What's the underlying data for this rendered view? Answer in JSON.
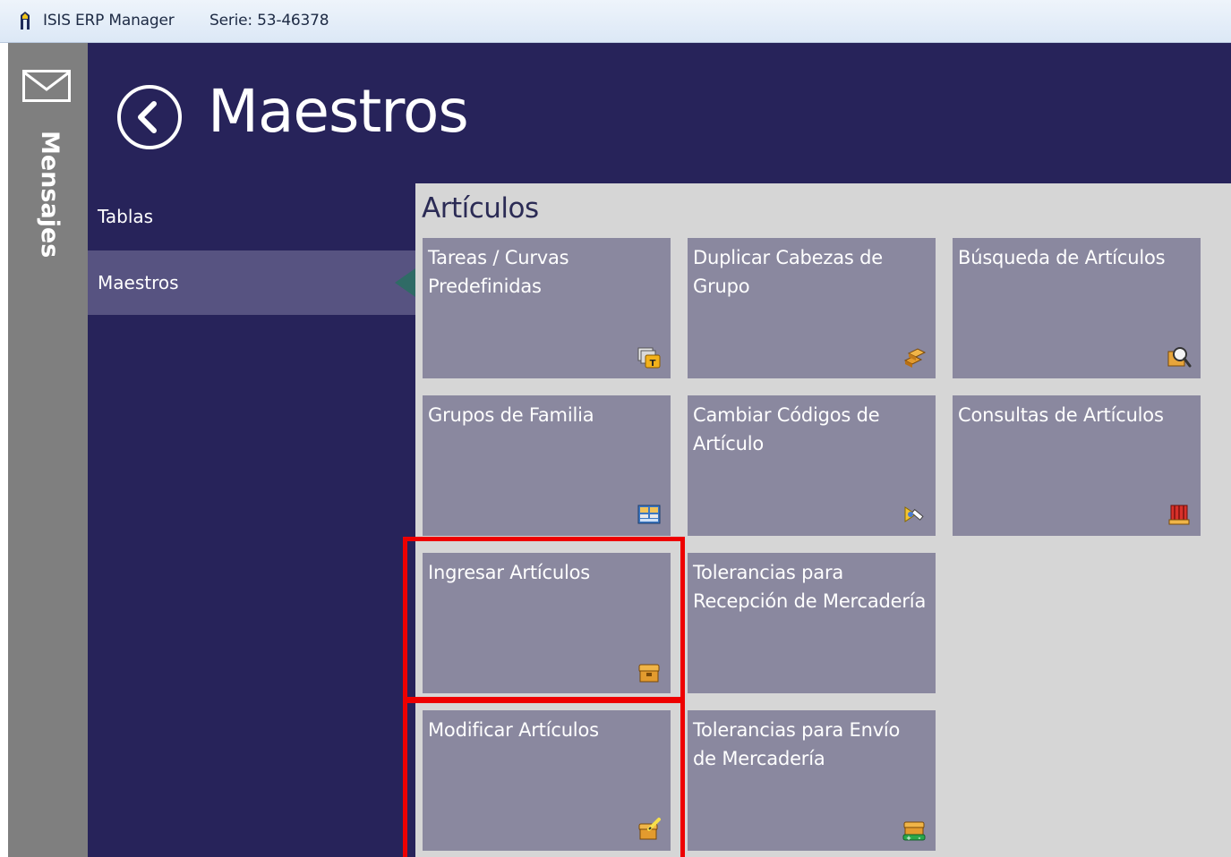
{
  "window": {
    "app_name": "ISIS ERP Manager",
    "serial": "Serie: 53-46378"
  },
  "messages": {
    "label": "Mensajes"
  },
  "header": {
    "title": "Maestros"
  },
  "nav": {
    "items": [
      {
        "label": "Tablas",
        "selected": false
      },
      {
        "label": "Maestros",
        "selected": true
      }
    ]
  },
  "section": {
    "title": "Artículos",
    "tiles": [
      {
        "label": "Tareas / Curvas Predefinidas",
        "icon": "folder-tasks-icon"
      },
      {
        "label": "Duplicar Cabezas de Grupo",
        "icon": "duplicate-blocks-icon"
      },
      {
        "label": "Búsqueda de Artículos",
        "icon": "search-articles-icon"
      },
      {
        "label": "Grupos de Familia",
        "icon": "family-groups-icon"
      },
      {
        "label": "Cambiar Códigos de Artículo",
        "icon": "change-codes-icon"
      },
      {
        "label": "Consultas de Artículos",
        "icon": "article-queries-icon"
      },
      {
        "label": "Ingresar Artículos",
        "icon": "add-article-box-icon"
      },
      {
        "label": "Tolerancias para Recepción de Mercadería",
        "icon": ""
      },
      {
        "label": "Modificar Artículos",
        "icon": "edit-article-box-icon"
      },
      {
        "label": "Tolerancias para Envío de Mercadería",
        "icon": "shipping-tolerance-icon"
      }
    ]
  },
  "colors": {
    "main_bg": "#27235a",
    "nav_selected": "#575381",
    "tile_bg": "#8a889f",
    "content_bg": "#d6d6d6",
    "highlight": "#ee0000"
  }
}
